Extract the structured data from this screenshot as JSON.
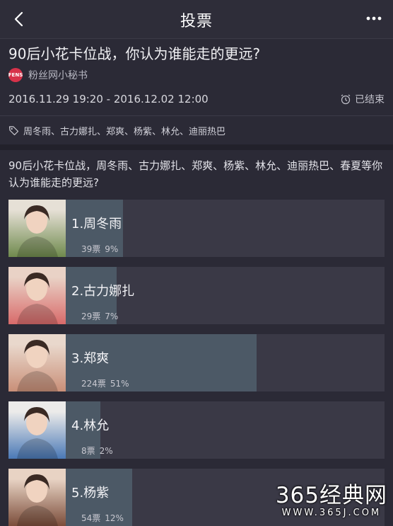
{
  "nav": {
    "title": "投票"
  },
  "vote": {
    "title": "90后小花卡位战，你认为谁能走的更远?",
    "author": "粉丝网小秘书",
    "avatar_text": "FENS",
    "time_range": "2016.11.29 19:20 - 2016.12.02 12:00",
    "status": "已结束",
    "tags": "周冬雨、古力娜扎、郑爽、杨紫、林允、迪丽热巴",
    "description": "90后小花卡位战，周冬雨、古力娜扎、郑爽、杨紫、林允、迪丽热巴、春夏等你认为谁能走的更远?"
  },
  "options": [
    {
      "name": "1.周冬雨",
      "votes": "39票",
      "percent": "9%",
      "fill": 0.09,
      "photo_bg": "#6f8a4d",
      "photo_top": "#e6e0d6"
    },
    {
      "name": "2.古力娜扎",
      "votes": "29票",
      "percent": "7%",
      "fill": 0.07,
      "photo_bg": "#d86a6a",
      "photo_top": "#e9d2c6"
    },
    {
      "name": "3.郑爽",
      "votes": "224票",
      "percent": "51%",
      "fill": 0.51,
      "photo_bg": "#c98f78",
      "photo_top": "#e9d8cc"
    },
    {
      "name": "4.林允",
      "votes": "8票",
      "percent": "2%",
      "fill": 0.02,
      "photo_bg": "#4a79b6",
      "photo_top": "#ecebea"
    },
    {
      "name": "5.杨紫",
      "votes": "54票",
      "percent": "12%",
      "fill": 0.12,
      "photo_bg": "#7b4d3a",
      "photo_top": "#e8d3c4"
    }
  ],
  "watermark": {
    "main": "365经典网",
    "sub": "WWW.365J.COM"
  }
}
